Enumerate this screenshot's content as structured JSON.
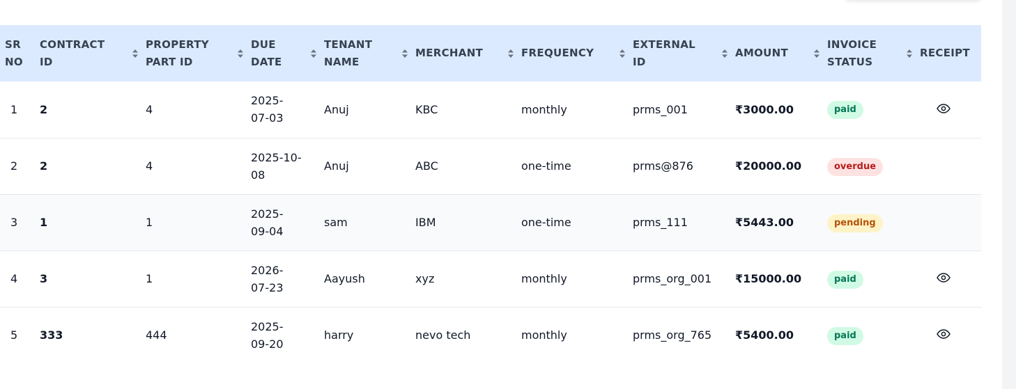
{
  "table": {
    "headers": [
      {
        "line1": "SR",
        "line2": "NO",
        "sortable": false
      },
      {
        "line1": "CONTRACT",
        "line2": "ID",
        "sortable": true
      },
      {
        "line1": "PROPERTY",
        "line2": "PART ID",
        "sortable": true
      },
      {
        "line1": "DUE",
        "line2": "DATE",
        "sortable": true
      },
      {
        "line1": "TENANT",
        "line2": "NAME",
        "sortable": true
      },
      {
        "line1": "MERCHANT",
        "line2": "",
        "sortable": true
      },
      {
        "line1": "FREQUENCY",
        "line2": "",
        "sortable": true
      },
      {
        "line1": "EXTERNAL",
        "line2": "ID",
        "sortable": true
      },
      {
        "line1": "AMOUNT",
        "line2": "",
        "sortable": true
      },
      {
        "line1": "INVOICE",
        "line2": "STATUS",
        "sortable": true
      },
      {
        "line1": "RECEIPT",
        "line2": "",
        "sortable": false
      }
    ],
    "rows": [
      {
        "sr": "1",
        "contract": "2",
        "property": "4",
        "due1": "2025-",
        "due2": "07-03",
        "tenant": "Anuj",
        "merchant": "KBC",
        "frequency": "monthly",
        "external": "prms_001",
        "amount": "₹3000.00",
        "status": "paid",
        "receipt": true
      },
      {
        "sr": "2",
        "contract": "2",
        "property": "4",
        "due1": "2025-10-",
        "due2": "08",
        "tenant": "Anuj",
        "merchant": "ABC",
        "frequency": "one-time",
        "external": "prms@876",
        "amount": "₹20000.00",
        "status": "overdue",
        "receipt": false
      },
      {
        "sr": "3",
        "contract": "1",
        "property": "1",
        "due1": "2025-",
        "due2": "09-04",
        "tenant": "sam",
        "merchant": "IBM",
        "frequency": "one-time",
        "external": "prms_111",
        "amount": "₹5443.00",
        "status": "pending",
        "receipt": false
      },
      {
        "sr": "4",
        "contract": "3",
        "property": "1",
        "due1": "2026-",
        "due2": "07-23",
        "tenant": "Aayush",
        "merchant": "xyz",
        "frequency": "monthly",
        "external": "prms_org_001",
        "amount": "₹15000.00",
        "status": "paid",
        "receipt": true
      },
      {
        "sr": "5",
        "contract": "333",
        "property": "444",
        "due1": "2025-",
        "due2": "09-20",
        "tenant": "harry",
        "merchant": "nevo tech",
        "frequency": "monthly",
        "external": "prms_org_765",
        "amount": "₹5400.00",
        "status": "paid",
        "receipt": true
      }
    ]
  },
  "icons": {
    "sort": "sort-arrows-icon",
    "receipt": "eye-icon"
  },
  "colors": {
    "header_bg": "#dbeafe",
    "paid_bg": "#d1fae5",
    "paid_text": "#047857",
    "overdue_bg": "#fee2e2",
    "overdue_text": "#b91c1c",
    "pending_bg": "#fef3c7",
    "pending_text": "#b45309"
  }
}
